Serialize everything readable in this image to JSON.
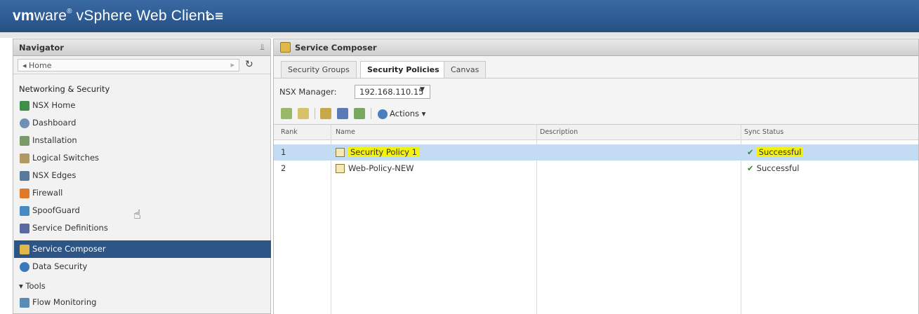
{
  "header": {
    "brand_vm": "vm",
    "brand_ware": "ware",
    "brand_app": "vSphere Web Client",
    "home_menu": "⌂≡"
  },
  "navigator": {
    "title": "Navigator",
    "pin_icon": "pin-icon",
    "home_label": "◂ Home",
    "section": "Networking & Security",
    "items": [
      {
        "label": "NSX Home",
        "icon": "nsx-home-icon",
        "color": "#3f8f4a"
      },
      {
        "label": "Dashboard",
        "icon": "dashboard-icon",
        "color": "#6f8fb5"
      },
      {
        "label": "Installation",
        "icon": "installation-icon",
        "color": "#7a9a6a"
      },
      {
        "label": "Logical Switches",
        "icon": "logical-switches-icon",
        "color": "#b09a62"
      },
      {
        "label": "NSX Edges",
        "icon": "nsx-edges-icon",
        "color": "#5a7a9a"
      },
      {
        "label": "Firewall",
        "icon": "firewall-icon",
        "color": "#e07a2a"
      },
      {
        "label": "SpoofGuard",
        "icon": "spoofguard-icon",
        "color": "#4a8ac4"
      },
      {
        "label": "Service Definitions",
        "icon": "service-definitions-icon",
        "color": "#5a6aa0"
      },
      {
        "label": "Service Composer",
        "icon": "service-composer-icon",
        "color": "#e0b84a",
        "selected": true
      },
      {
        "label": "Data Security",
        "icon": "data-security-icon",
        "color": "#3a7ab8"
      }
    ],
    "tools_label": "▾ Tools",
    "tools_items": [
      {
        "label": "Flow Monitoring",
        "icon": "flow-monitoring-icon",
        "color": "#5a8ab8"
      }
    ]
  },
  "main": {
    "title": "Service Composer",
    "tabs": [
      {
        "label": "Security Groups",
        "active": false
      },
      {
        "label": "Security Policies",
        "active": true
      },
      {
        "label": "Canvas",
        "active": false
      }
    ],
    "nsx_manager_label": "NSX Manager:",
    "nsx_manager_value": "192.168.110.15",
    "actions_label": "Actions ▾",
    "columns": [
      "Rank",
      "Name",
      "Description",
      "Sync Status"
    ],
    "rows": [
      {
        "rank": "1",
        "name": "Security Policy 1",
        "description": "",
        "status": "Successful",
        "selected": true,
        "highlighted": true
      },
      {
        "rank": "2",
        "name": "Web-Policy-NEW",
        "description": "",
        "status": "Successful",
        "selected": false,
        "highlighted": false
      }
    ]
  }
}
